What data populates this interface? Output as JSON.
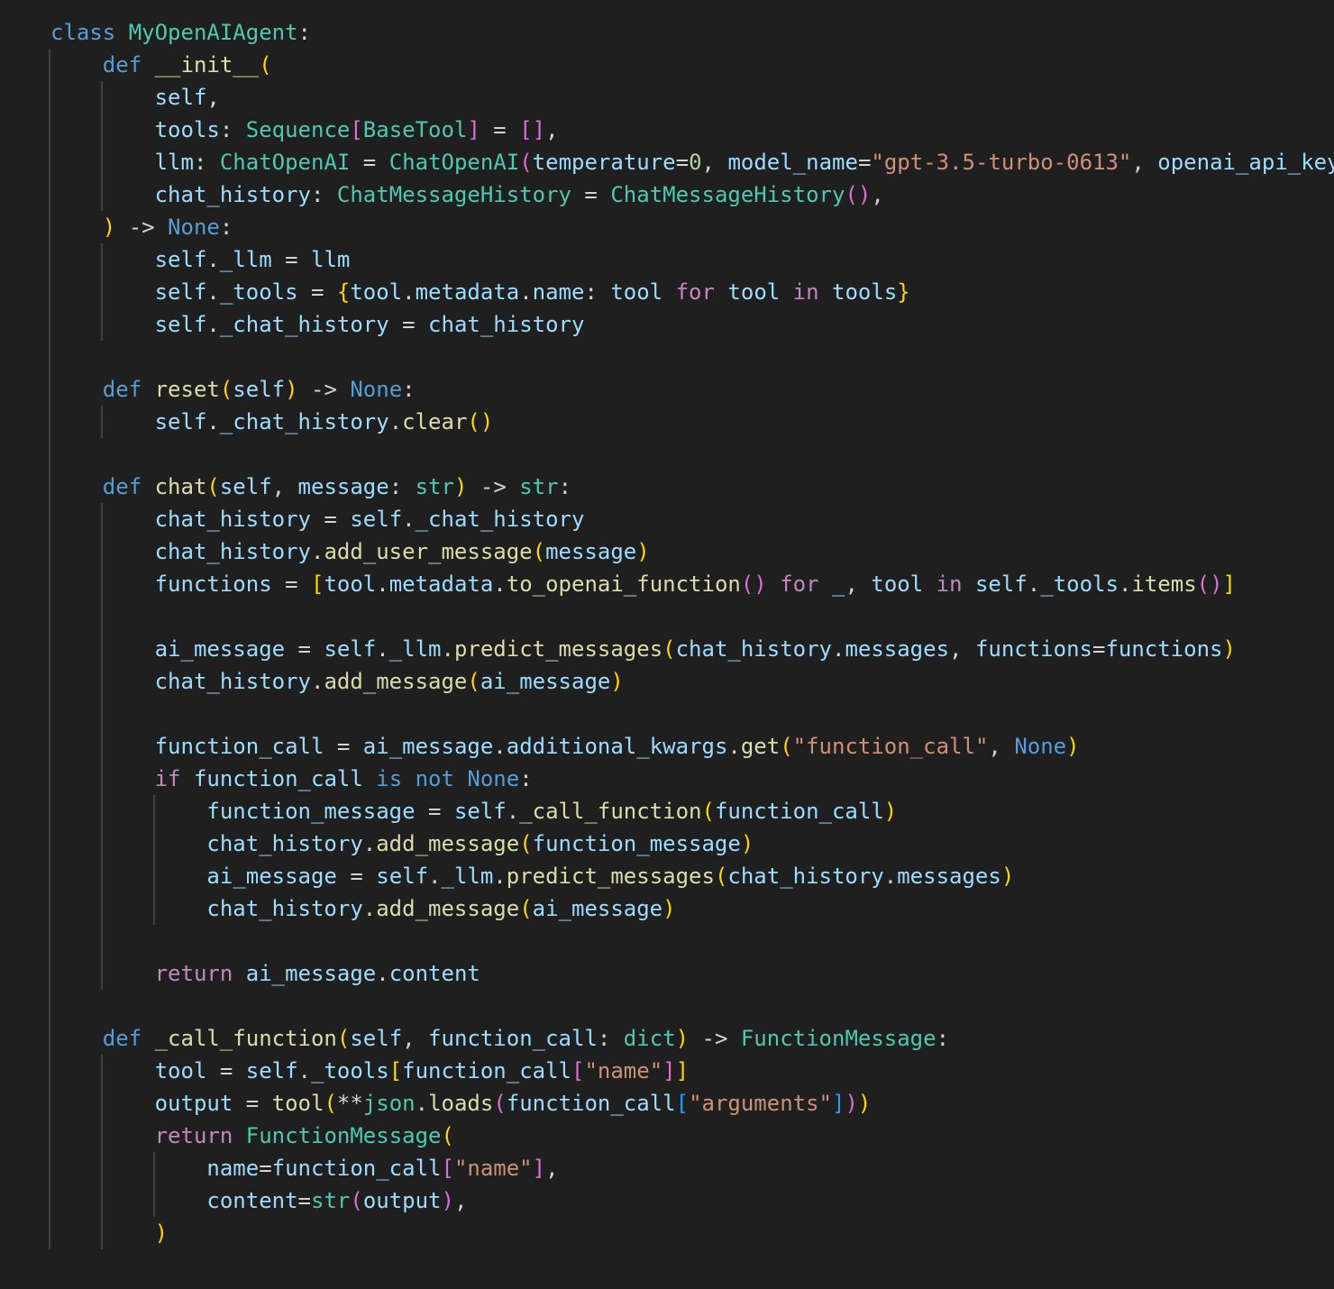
{
  "editor": {
    "language": "python",
    "theme_colors": {
      "background": "#1f1f1f",
      "keyword": "#569cd6",
      "control": "#c586c0",
      "class": "#4ec9b0",
      "function": "#dcdcaa",
      "variable": "#9cdcfe",
      "string": "#ce9178",
      "number": "#b5cea8",
      "operator": "#d4d4d4",
      "bracket_level_1": "#ffd700",
      "bracket_level_2": "#da70d6",
      "bracket_level_3": "#179fff"
    },
    "lines": [
      [
        [
          "kw",
          "class "
        ],
        [
          "cls",
          "MyOpenAIAgent"
        ],
        [
          "op",
          ":"
        ]
      ],
      [
        [
          "op",
          "    "
        ],
        [
          "kw",
          "def "
        ],
        [
          "fn",
          "__init__"
        ],
        [
          "b1",
          "("
        ]
      ],
      [
        [
          "op",
          "        "
        ],
        [
          "var",
          "self"
        ],
        [
          "op",
          ","
        ]
      ],
      [
        [
          "op",
          "        "
        ],
        [
          "var",
          "tools"
        ],
        [
          "op",
          ": "
        ],
        [
          "cls",
          "Sequence"
        ],
        [
          "b2",
          "["
        ],
        [
          "cls",
          "BaseTool"
        ],
        [
          "b2",
          "]"
        ],
        [
          "op",
          " = "
        ],
        [
          "b2",
          "[]"
        ],
        [
          "op",
          ","
        ]
      ],
      [
        [
          "op",
          "        "
        ],
        [
          "var",
          "llm"
        ],
        [
          "op",
          ": "
        ],
        [
          "cls",
          "ChatOpenAI"
        ],
        [
          "op",
          " = "
        ],
        [
          "cls",
          "ChatOpenAI"
        ],
        [
          "b2",
          "("
        ],
        [
          "var",
          "temperature"
        ],
        [
          "op",
          "="
        ],
        [
          "num",
          "0"
        ],
        [
          "op",
          ", "
        ],
        [
          "var",
          "model_name"
        ],
        [
          "op",
          "="
        ],
        [
          "str",
          "\"gpt-3.5-turbo-0613\""
        ],
        [
          "op",
          ", "
        ],
        [
          "var",
          "openai_api_key"
        ]
      ],
      [
        [
          "op",
          "        "
        ],
        [
          "var",
          "chat_history"
        ],
        [
          "op",
          ": "
        ],
        [
          "cls",
          "ChatMessageHistory"
        ],
        [
          "op",
          " = "
        ],
        [
          "cls",
          "ChatMessageHistory"
        ],
        [
          "b2",
          "()"
        ],
        [
          "op",
          ","
        ]
      ],
      [
        [
          "op",
          "    "
        ],
        [
          "b1",
          ")"
        ],
        [
          "op",
          " -> "
        ],
        [
          "kw",
          "None"
        ],
        [
          "op",
          ":"
        ]
      ],
      [
        [
          "op",
          "        "
        ],
        [
          "var",
          "self"
        ],
        [
          "op",
          "."
        ],
        [
          "var",
          "_llm"
        ],
        [
          "op",
          " = "
        ],
        [
          "var",
          "llm"
        ]
      ],
      [
        [
          "op",
          "        "
        ],
        [
          "var",
          "self"
        ],
        [
          "op",
          "."
        ],
        [
          "var",
          "_tools"
        ],
        [
          "op",
          " = "
        ],
        [
          "b1",
          "{"
        ],
        [
          "var",
          "tool"
        ],
        [
          "op",
          "."
        ],
        [
          "var",
          "metadata"
        ],
        [
          "op",
          "."
        ],
        [
          "var",
          "name"
        ],
        [
          "op",
          ": "
        ],
        [
          "var",
          "tool"
        ],
        [
          "op",
          " "
        ],
        [
          "ctrl",
          "for"
        ],
        [
          "op",
          " "
        ],
        [
          "var",
          "tool"
        ],
        [
          "op",
          " "
        ],
        [
          "ctrl",
          "in"
        ],
        [
          "op",
          " "
        ],
        [
          "var",
          "tools"
        ],
        [
          "b1",
          "}"
        ]
      ],
      [
        [
          "op",
          "        "
        ],
        [
          "var",
          "self"
        ],
        [
          "op",
          "."
        ],
        [
          "var",
          "_chat_history"
        ],
        [
          "op",
          " = "
        ],
        [
          "var",
          "chat_history"
        ]
      ],
      [],
      [
        [
          "op",
          "    "
        ],
        [
          "kw",
          "def "
        ],
        [
          "fn",
          "reset"
        ],
        [
          "b1",
          "("
        ],
        [
          "var",
          "self"
        ],
        [
          "b1",
          ")"
        ],
        [
          "op",
          " -> "
        ],
        [
          "kw",
          "None"
        ],
        [
          "op",
          ":"
        ]
      ],
      [
        [
          "op",
          "        "
        ],
        [
          "var",
          "self"
        ],
        [
          "op",
          "."
        ],
        [
          "var",
          "_chat_history"
        ],
        [
          "op",
          "."
        ],
        [
          "fn",
          "clear"
        ],
        [
          "b1",
          "()"
        ]
      ],
      [],
      [
        [
          "op",
          "    "
        ],
        [
          "kw",
          "def "
        ],
        [
          "fn",
          "chat"
        ],
        [
          "b1",
          "("
        ],
        [
          "var",
          "self"
        ],
        [
          "op",
          ", "
        ],
        [
          "var",
          "message"
        ],
        [
          "op",
          ": "
        ],
        [
          "cls",
          "str"
        ],
        [
          "b1",
          ")"
        ],
        [
          "op",
          " -> "
        ],
        [
          "cls",
          "str"
        ],
        [
          "op",
          ":"
        ]
      ],
      [
        [
          "op",
          "        "
        ],
        [
          "var",
          "chat_history"
        ],
        [
          "op",
          " = "
        ],
        [
          "var",
          "self"
        ],
        [
          "op",
          "."
        ],
        [
          "var",
          "_chat_history"
        ]
      ],
      [
        [
          "op",
          "        "
        ],
        [
          "var",
          "chat_history"
        ],
        [
          "op",
          "."
        ],
        [
          "fn",
          "add_user_message"
        ],
        [
          "b1",
          "("
        ],
        [
          "var",
          "message"
        ],
        [
          "b1",
          ")"
        ]
      ],
      [
        [
          "op",
          "        "
        ],
        [
          "var",
          "functions"
        ],
        [
          "op",
          " = "
        ],
        [
          "b1",
          "["
        ],
        [
          "var",
          "tool"
        ],
        [
          "op",
          "."
        ],
        [
          "var",
          "metadata"
        ],
        [
          "op",
          "."
        ],
        [
          "fn",
          "to_openai_function"
        ],
        [
          "b2",
          "()"
        ],
        [
          "op",
          " "
        ],
        [
          "ctrl",
          "for"
        ],
        [
          "op",
          " "
        ],
        [
          "var",
          "_"
        ],
        [
          "op",
          ", "
        ],
        [
          "var",
          "tool"
        ],
        [
          "op",
          " "
        ],
        [
          "ctrl",
          "in"
        ],
        [
          "op",
          " "
        ],
        [
          "var",
          "self"
        ],
        [
          "op",
          "."
        ],
        [
          "var",
          "_tools"
        ],
        [
          "op",
          "."
        ],
        [
          "fn",
          "items"
        ],
        [
          "b2",
          "()"
        ],
        [
          "b1",
          "]"
        ]
      ],
      [],
      [
        [
          "op",
          "        "
        ],
        [
          "var",
          "ai_message"
        ],
        [
          "op",
          " = "
        ],
        [
          "var",
          "self"
        ],
        [
          "op",
          "."
        ],
        [
          "var",
          "_llm"
        ],
        [
          "op",
          "."
        ],
        [
          "fn",
          "predict_messages"
        ],
        [
          "b1",
          "("
        ],
        [
          "var",
          "chat_history"
        ],
        [
          "op",
          "."
        ],
        [
          "var",
          "messages"
        ],
        [
          "op",
          ", "
        ],
        [
          "var",
          "functions"
        ],
        [
          "op",
          "="
        ],
        [
          "var",
          "functions"
        ],
        [
          "b1",
          ")"
        ]
      ],
      [
        [
          "op",
          "        "
        ],
        [
          "var",
          "chat_history"
        ],
        [
          "op",
          "."
        ],
        [
          "fn",
          "add_message"
        ],
        [
          "b1",
          "("
        ],
        [
          "var",
          "ai_message"
        ],
        [
          "b1",
          ")"
        ]
      ],
      [],
      [
        [
          "op",
          "        "
        ],
        [
          "var",
          "function_call"
        ],
        [
          "op",
          " = "
        ],
        [
          "var",
          "ai_message"
        ],
        [
          "op",
          "."
        ],
        [
          "var",
          "additional_kwargs"
        ],
        [
          "op",
          "."
        ],
        [
          "fn",
          "get"
        ],
        [
          "b1",
          "("
        ],
        [
          "str",
          "\"function_call\""
        ],
        [
          "op",
          ", "
        ],
        [
          "kw",
          "None"
        ],
        [
          "b1",
          ")"
        ]
      ],
      [
        [
          "op",
          "        "
        ],
        [
          "ctrl",
          "if"
        ],
        [
          "op",
          " "
        ],
        [
          "var",
          "function_call"
        ],
        [
          "op",
          " "
        ],
        [
          "kw",
          "is not None"
        ],
        [
          "op",
          ":"
        ]
      ],
      [
        [
          "op",
          "            "
        ],
        [
          "var",
          "function_message"
        ],
        [
          "op",
          " = "
        ],
        [
          "var",
          "self"
        ],
        [
          "op",
          "."
        ],
        [
          "fn",
          "_call_function"
        ],
        [
          "b1",
          "("
        ],
        [
          "var",
          "function_call"
        ],
        [
          "b1",
          ")"
        ]
      ],
      [
        [
          "op",
          "            "
        ],
        [
          "var",
          "chat_history"
        ],
        [
          "op",
          "."
        ],
        [
          "fn",
          "add_message"
        ],
        [
          "b1",
          "("
        ],
        [
          "var",
          "function_message"
        ],
        [
          "b1",
          ")"
        ]
      ],
      [
        [
          "op",
          "            "
        ],
        [
          "var",
          "ai_message"
        ],
        [
          "op",
          " = "
        ],
        [
          "var",
          "self"
        ],
        [
          "op",
          "."
        ],
        [
          "var",
          "_llm"
        ],
        [
          "op",
          "."
        ],
        [
          "fn",
          "predict_messages"
        ],
        [
          "b1",
          "("
        ],
        [
          "var",
          "chat_history"
        ],
        [
          "op",
          "."
        ],
        [
          "var",
          "messages"
        ],
        [
          "b1",
          ")"
        ]
      ],
      [
        [
          "op",
          "            "
        ],
        [
          "var",
          "chat_history"
        ],
        [
          "op",
          "."
        ],
        [
          "fn",
          "add_message"
        ],
        [
          "b1",
          "("
        ],
        [
          "var",
          "ai_message"
        ],
        [
          "b1",
          ")"
        ]
      ],
      [],
      [
        [
          "op",
          "        "
        ],
        [
          "ctrl",
          "return"
        ],
        [
          "op",
          " "
        ],
        [
          "var",
          "ai_message"
        ],
        [
          "op",
          "."
        ],
        [
          "var",
          "content"
        ]
      ],
      [],
      [
        [
          "op",
          "    "
        ],
        [
          "kw",
          "def "
        ],
        [
          "fn",
          "_call_function"
        ],
        [
          "b1",
          "("
        ],
        [
          "var",
          "self"
        ],
        [
          "op",
          ", "
        ],
        [
          "var",
          "function_call"
        ],
        [
          "op",
          ": "
        ],
        [
          "cls",
          "dict"
        ],
        [
          "b1",
          ")"
        ],
        [
          "op",
          " -> "
        ],
        [
          "cls",
          "FunctionMessage"
        ],
        [
          "op",
          ":"
        ]
      ],
      [
        [
          "op",
          "        "
        ],
        [
          "var",
          "tool"
        ],
        [
          "op",
          " = "
        ],
        [
          "var",
          "self"
        ],
        [
          "op",
          "."
        ],
        [
          "var",
          "_tools"
        ],
        [
          "b1",
          "["
        ],
        [
          "var",
          "function_call"
        ],
        [
          "b2",
          "["
        ],
        [
          "str",
          "\"name\""
        ],
        [
          "b2",
          "]"
        ],
        [
          "b1",
          "]"
        ]
      ],
      [
        [
          "op",
          "        "
        ],
        [
          "var",
          "output"
        ],
        [
          "op",
          " = "
        ],
        [
          "fn",
          "tool"
        ],
        [
          "b1",
          "("
        ],
        [
          "op",
          "**"
        ],
        [
          "cls",
          "json"
        ],
        [
          "op",
          "."
        ],
        [
          "fn",
          "loads"
        ],
        [
          "b2",
          "("
        ],
        [
          "var",
          "function_call"
        ],
        [
          "b3",
          "["
        ],
        [
          "str",
          "\"arguments\""
        ],
        [
          "b3",
          "]"
        ],
        [
          "b2",
          ")"
        ],
        [
          "b1",
          ")"
        ]
      ],
      [
        [
          "op",
          "        "
        ],
        [
          "ctrl",
          "return"
        ],
        [
          "op",
          " "
        ],
        [
          "cls",
          "FunctionMessage"
        ],
        [
          "b1",
          "("
        ]
      ],
      [
        [
          "op",
          "            "
        ],
        [
          "var",
          "name"
        ],
        [
          "op",
          "="
        ],
        [
          "var",
          "function_call"
        ],
        [
          "b2",
          "["
        ],
        [
          "str",
          "\"name\""
        ],
        [
          "b2",
          "]"
        ],
        [
          "op",
          ","
        ]
      ],
      [
        [
          "op",
          "            "
        ],
        [
          "var",
          "content"
        ],
        [
          "op",
          "="
        ],
        [
          "cls",
          "str"
        ],
        [
          "b2",
          "("
        ],
        [
          "var",
          "output"
        ],
        [
          "b2",
          ")"
        ],
        [
          "op",
          ","
        ]
      ],
      [
        [
          "op",
          "        "
        ],
        [
          "b1",
          ")"
        ]
      ]
    ]
  }
}
